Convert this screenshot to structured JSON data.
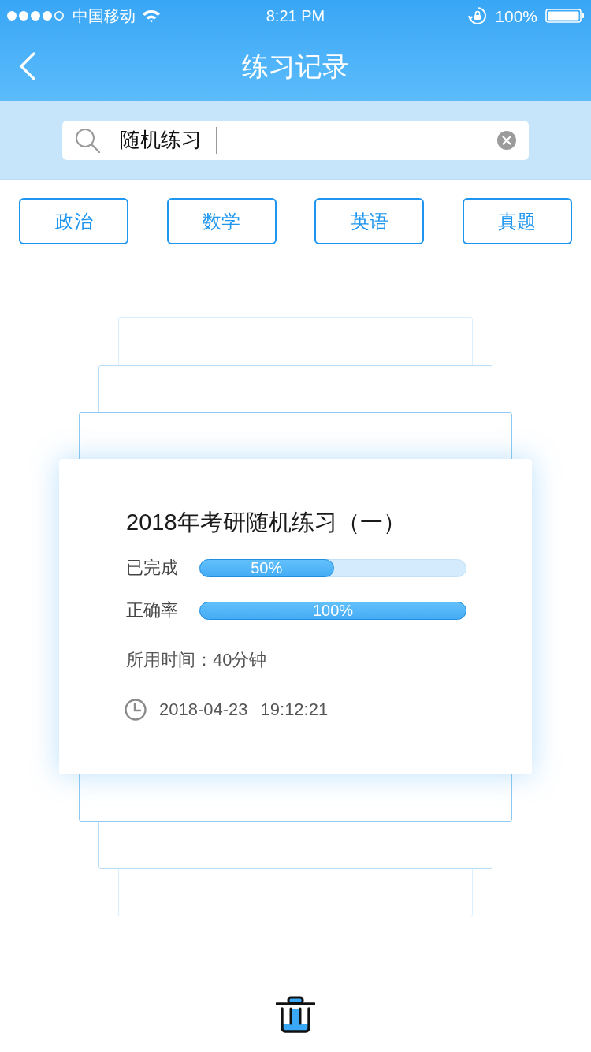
{
  "status_bar": {
    "carrier": "中国移动",
    "time": "8:21 PM",
    "battery": "100%"
  },
  "nav_bar": {
    "title": "练习记录"
  },
  "search": {
    "value": "随机练习"
  },
  "tabs": [
    {
      "label": "政治",
      "selected": false
    },
    {
      "label": "数学",
      "selected": false
    },
    {
      "label": "英语",
      "selected": false
    },
    {
      "label": "真题",
      "selected": false
    }
  ],
  "record_card": {
    "title": "2018年考研随机练习（一）",
    "progress": [
      {
        "label": "已完成",
        "level": 0.5,
        "reading": "50%"
      },
      {
        "label": "正确率",
        "level": 1,
        "reading": "100%"
      }
    ],
    "time_used": "所用时间：40分钟",
    "date": "2018-04-23",
    "time": "19:12:21"
  }
}
